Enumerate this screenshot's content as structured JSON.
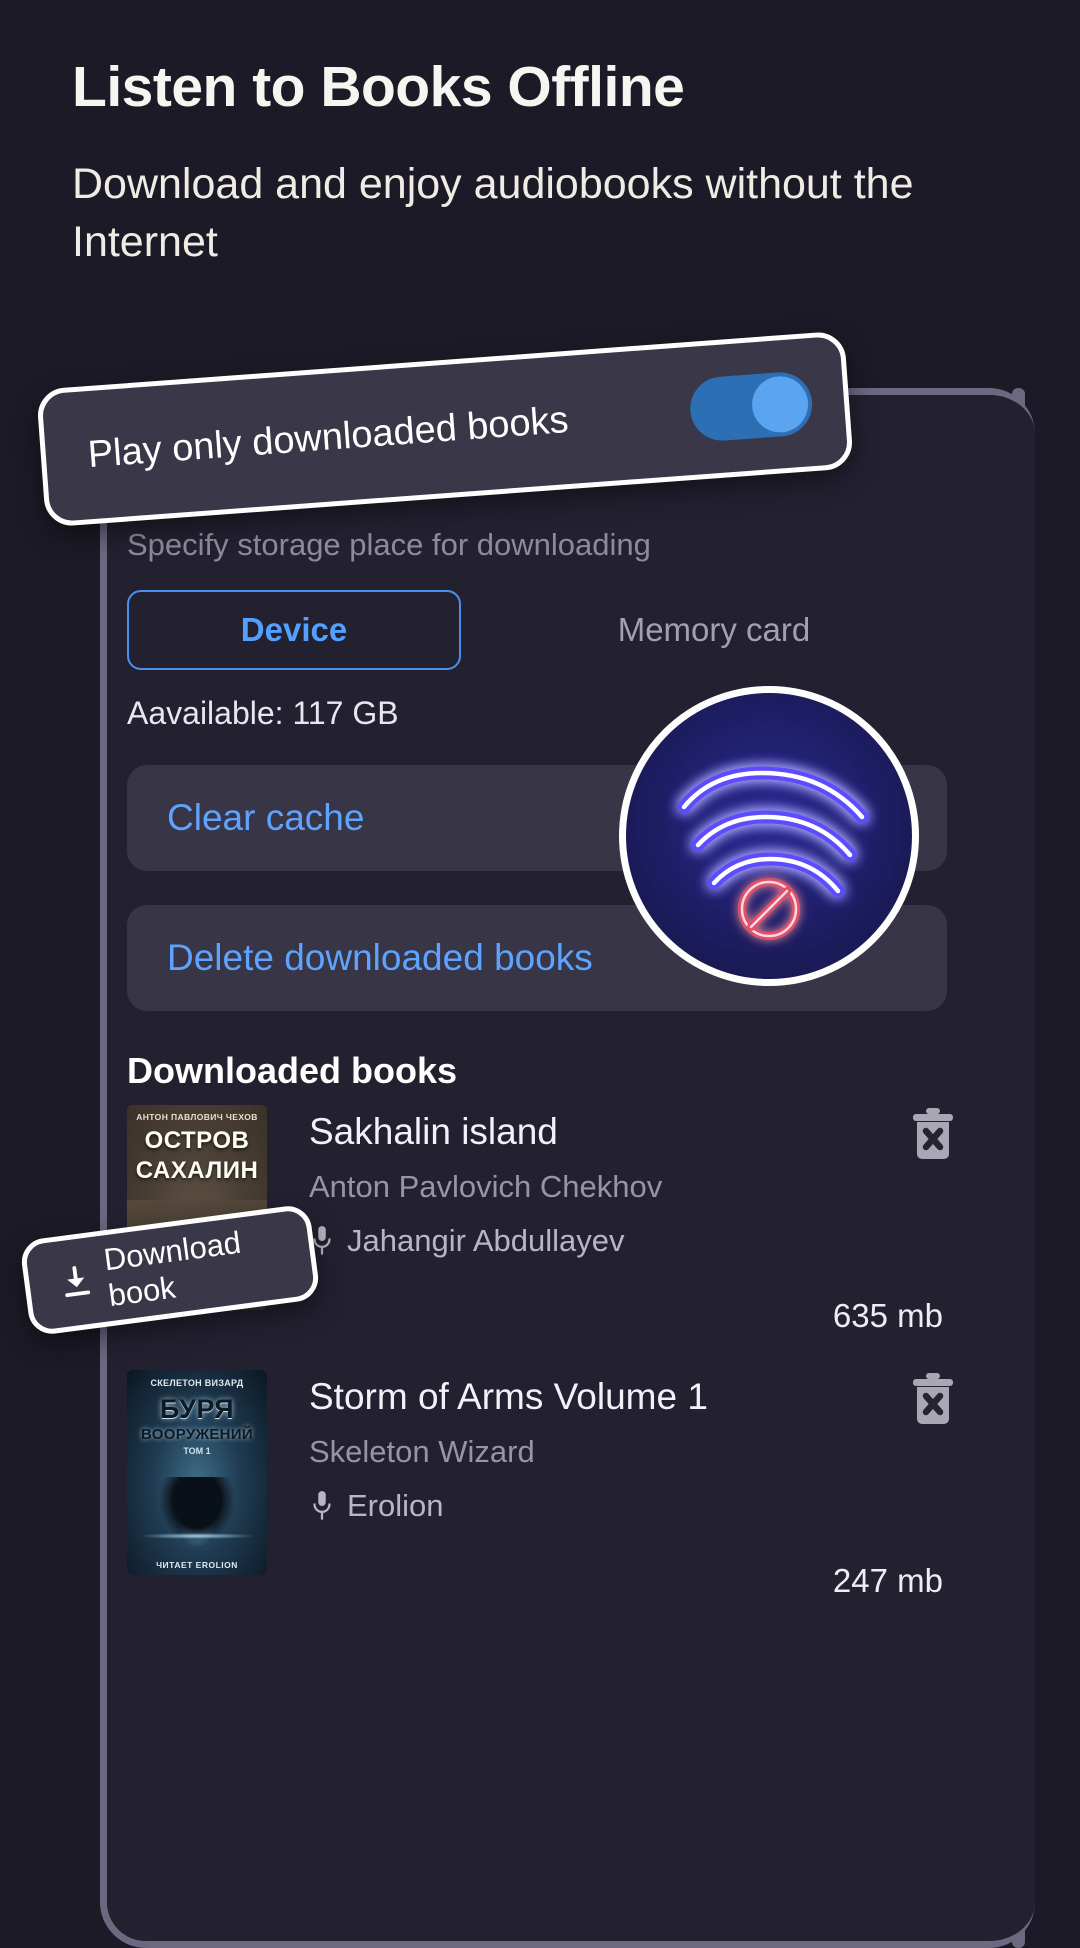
{
  "header": {
    "headline": "Listen to Books Offline",
    "subhead": "Download and enjoy audiobooks without the Internet"
  },
  "callouts": {
    "toggle": {
      "label": "Play only downloaded books",
      "state": "on"
    },
    "download": {
      "label": "Download book",
      "icon": "download-icon"
    }
  },
  "settings": {
    "specify_label": "Specify storage place for downloading",
    "tabs": [
      {
        "label": "Device",
        "selected": true
      },
      {
        "label": "Memory card",
        "selected": false
      }
    ],
    "available": "Aavailable: 117 GB",
    "clear_cache_label": "Clear cache",
    "delete_downloaded_label": "Delete downloaded books",
    "downloaded_heading": "Downloaded books"
  },
  "books": [
    {
      "title": "Sakhalin island",
      "author": "Anton Pavlovich Chekhov",
      "narrator": "Jahangir Abdullayev",
      "size": "635 mb",
      "delete_icon": "trash-x-icon",
      "mic_icon": "microphone-icon",
      "cover": {
        "author_line": "АНТОН ПАВЛОВИЧ ЧЕХОВ",
        "title_line_1": "ОСТРОВ",
        "title_line_2": "САХАЛИН"
      }
    },
    {
      "title": "Storm of Arms Volume 1",
      "author": "Skeleton Wizard",
      "narrator": "Erolion",
      "size": "247 mb",
      "delete_icon": "trash-x-icon",
      "mic_icon": "microphone-icon",
      "cover": {
        "author_line": "СКЕЛЕТОН ВИЗАРД",
        "title_line_1": "БУРЯ",
        "title_line_2": "ВООРУЖЕНИЙ",
        "title_line_3": "ТОМ 1",
        "footer_line": "ЧИТАЕТ EROLION"
      }
    }
  ],
  "badge": {
    "icon": "wifi-off-icon"
  },
  "colors": {
    "background": "#1c1a26",
    "panel": "#232130",
    "accent_blue": "#5fa3ff",
    "tab_border": "#4a8ef0",
    "toggle_track": "#2d6fb5",
    "toggle_knob": "#5ba4f0",
    "neon_blue": "#4b3ef0",
    "neon_red": "#e0506b",
    "callout_bg": "#3a3848",
    "muted_text": "#8d8b99"
  }
}
